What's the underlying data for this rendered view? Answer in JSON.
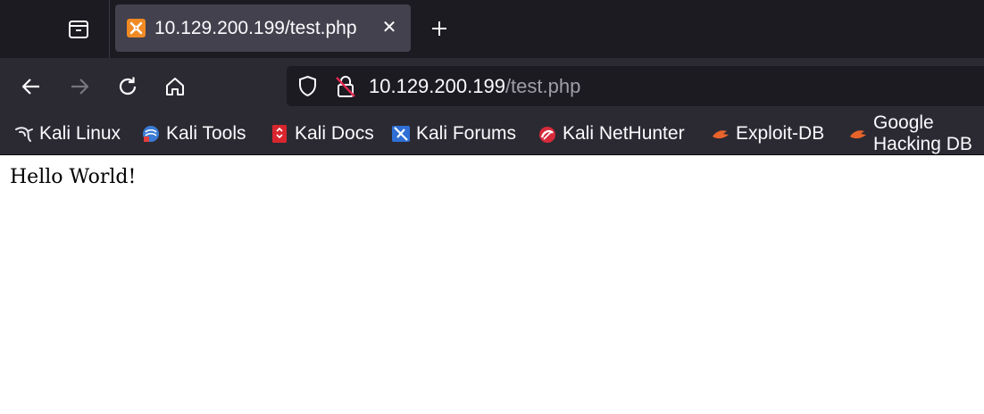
{
  "tab": {
    "title": "10.129.200.199/test.php",
    "close_glyph": "✕",
    "favicon": "xampp-icon"
  },
  "urlbar": {
    "host": "10.129.200.199",
    "path": "/test.php"
  },
  "bookmarks": [
    {
      "label": "Kali Linux",
      "icon": "kali-dragon-icon"
    },
    {
      "label": "Kali Tools",
      "icon": "kali-tools-icon"
    },
    {
      "label": "Kali Docs",
      "icon": "kali-docs-icon"
    },
    {
      "label": "Kali Forums",
      "icon": "kali-forums-icon"
    },
    {
      "label": "Kali NetHunter",
      "icon": "kali-nethunter-icon"
    },
    {
      "label": "Exploit-DB",
      "icon": "exploit-db-icon"
    },
    {
      "label": "Google Hacking DB",
      "icon": "exploit-db-icon"
    }
  ],
  "page": {
    "text": "Hello World!"
  },
  "colors": {
    "tabbar_bg": "#1c1b22",
    "toolbar_bg": "#2b2a33",
    "active_tab_bg": "#42414d",
    "text_light": "#fbfbfe",
    "url_path_dim": "#9f9ea6"
  }
}
